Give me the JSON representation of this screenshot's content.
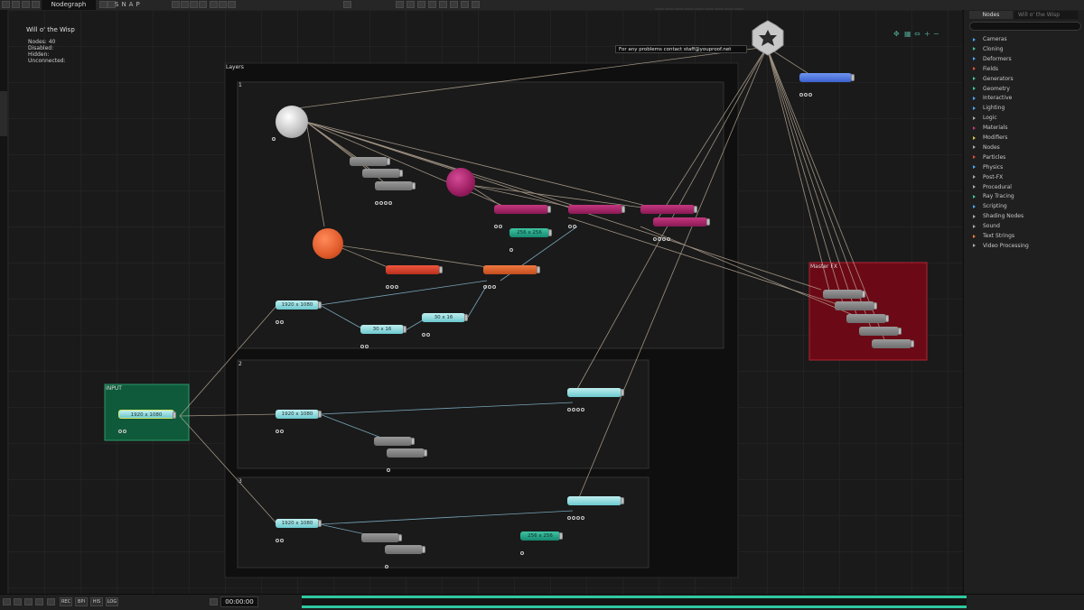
{
  "topbar": {
    "tab": "Nodegraph",
    "snap": "SNAP",
    "transport": [
      "⏮",
      "◀◀",
      "◀",
      "■",
      "▶",
      "▶▶",
      "⏭",
      "○",
      "⏺"
    ]
  },
  "graph": {
    "title": "Will o' the Wisp",
    "stats": {
      "nodes": "Nodes: 40",
      "disabled": "Disabled:",
      "hidden": "Hidden:",
      "unconnected": "Unconnected:"
    },
    "message": "For any problems contact staff@youproof.net"
  },
  "groups": {
    "layers": "Layers",
    "sub1": "1",
    "sub2": "2",
    "sub3": "3",
    "input": "INPUT",
    "master": "Master FX"
  },
  "nodes": {
    "res_a": "1920 x 1080",
    "res_input": "1920 x 1080",
    "res_2": "1920 x 1080",
    "res_3": "1920 x 1080",
    "small_a": "30 x 16",
    "small_b": "30 x 16",
    "tex_a": "256 x 256",
    "tex_b": "256 x 256"
  },
  "right_panel": {
    "tab": "Nodes",
    "tab2": "Will o' the Wisp",
    "search_placeholder": "",
    "categories": [
      {
        "label": "Cameras",
        "color": "#4aa8ff"
      },
      {
        "label": "Cloning",
        "color": "#3fc4a2"
      },
      {
        "label": "Deformers",
        "color": "#4aa8ff"
      },
      {
        "label": "Fields",
        "color": "#e0503a"
      },
      {
        "label": "Generators",
        "color": "#3fc4a2"
      },
      {
        "label": "Geometry",
        "color": "#3fc4a2"
      },
      {
        "label": "Interactive",
        "color": "#4aa8ff"
      },
      {
        "label": "Lighting",
        "color": "#4aa8ff"
      },
      {
        "label": "Logic",
        "color": "#aaaaaa"
      },
      {
        "label": "Materials",
        "color": "#c4367f"
      },
      {
        "label": "Modifiers",
        "color": "#d6c94a"
      },
      {
        "label": "Nodes",
        "color": "#aaaaaa"
      },
      {
        "label": "Particles",
        "color": "#e0503a"
      },
      {
        "label": "Physics",
        "color": "#4aa8ff"
      },
      {
        "label": "Post-FX",
        "color": "#aaaaaa"
      },
      {
        "label": "Procedural",
        "color": "#aaaaaa"
      },
      {
        "label": "Ray Tracing",
        "color": "#3fc4a2"
      },
      {
        "label": "Scripting",
        "color": "#4aa8ff"
      },
      {
        "label": "Shading Nodes",
        "color": "#aaaaaa"
      },
      {
        "label": "Sound",
        "color": "#aaaaaa"
      },
      {
        "label": "Text Strings",
        "color": "#f07a40"
      },
      {
        "label": "Video Processing",
        "color": "#aaaaaa"
      }
    ]
  },
  "bottombar": {
    "buttons": [
      "REC",
      "BPI",
      "HIS",
      "LOG"
    ],
    "timecode": "00:00:00"
  }
}
